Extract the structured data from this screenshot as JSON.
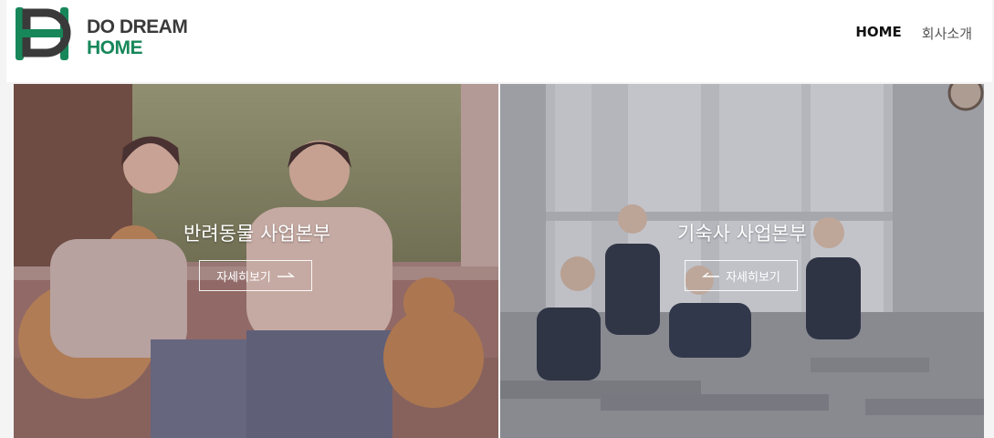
{
  "header": {
    "logo": {
      "line1": "DO DREAM",
      "line2": "HOME"
    },
    "nav": [
      {
        "label": "HOME"
      },
      {
        "label": "회사소개"
      }
    ]
  },
  "panels": [
    {
      "title": "반려동물 사업본부",
      "button_label": "자세히보기",
      "arrow": "right-arrow-icon"
    },
    {
      "title": "기숙사 사업본부",
      "button_label": "자세히보기",
      "arrow": "left-arrow-icon"
    }
  ],
  "colors": {
    "brand_green": "#17875a",
    "logo_dark": "#3a3a3a",
    "overlay": "#7a5060"
  }
}
